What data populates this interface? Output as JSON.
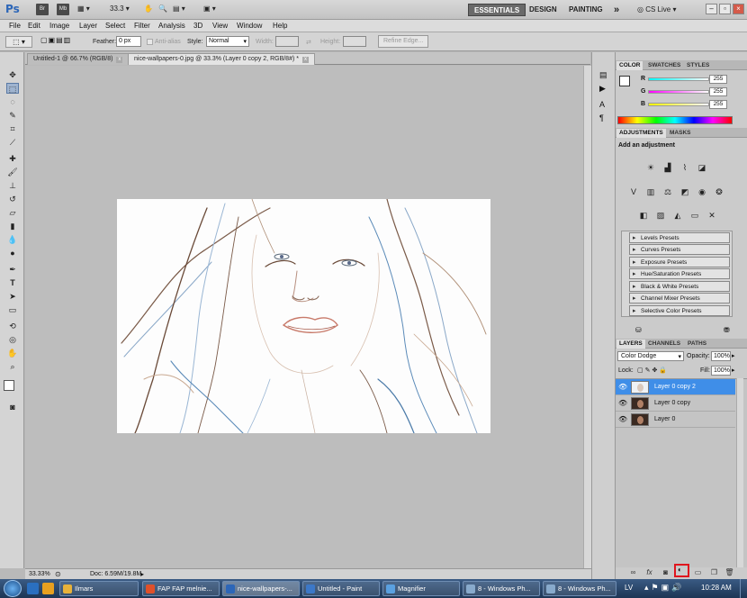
{
  "appbar": {
    "logo": "Ps",
    "icon_br": "Br",
    "icon_mb": "Mb",
    "zoom_value": "33.3",
    "workspaces": [
      "ESSENTIALS",
      "DESIGN",
      "PAINTING"
    ],
    "more": "»",
    "cslive": "CS Live"
  },
  "menu": [
    "File",
    "Edit",
    "Image",
    "Layer",
    "Select",
    "Filter",
    "Analysis",
    "3D",
    "View",
    "Window",
    "Help"
  ],
  "options": {
    "feather_label": "Feather:",
    "feather_value": "0 px",
    "antialias_label": "Anti-alias",
    "style_label": "Style:",
    "style_value": "Normal",
    "width_label": "Width:",
    "height_label": "Height:",
    "refine_label": "Refine Edge..."
  },
  "tabs": [
    {
      "label": "Untitled-1 @ 66.7% (RGB/8)",
      "close": "x"
    },
    {
      "label": "nice-wallpapers-0.jpg @ 33.3% (Layer 0 copy 2, RGB/8#) *",
      "close": "x"
    }
  ],
  "status": {
    "zoom": "33.33%",
    "doc": "Doc: 6.59M/19.8M"
  },
  "color_panel": {
    "tabs": [
      "COLOR",
      "SWATCHES",
      "STYLES"
    ],
    "channels": [
      {
        "label": "R",
        "value": "255",
        "color": "#e04040"
      },
      {
        "label": "G",
        "value": "255",
        "color": "#40c040"
      },
      {
        "label": "B",
        "value": "255",
        "color": "#4060e0"
      }
    ]
  },
  "adjustments": {
    "tabs": [
      "ADJUSTMENTS",
      "MASKS"
    ],
    "heading": "Add an adjustment",
    "presets": [
      "Levels Presets",
      "Curves Presets",
      "Exposure Presets",
      "Hue/Saturation Presets",
      "Black & White Presets",
      "Channel Mixer Presets",
      "Selective Color Presets"
    ]
  },
  "layers_panel": {
    "tabs": [
      "LAYERS",
      "CHANNELS",
      "PATHS"
    ],
    "blend_mode": "Color Dodge",
    "opacity_label": "Opacity:",
    "opacity_value": "100%",
    "lock_label": "Lock:",
    "fill_label": "Fill:",
    "fill_value": "100%",
    "layers": [
      {
        "name": "Layer 0 copy 2",
        "selected": true
      },
      {
        "name": "Layer 0 copy",
        "selected": false
      },
      {
        "name": "Layer 0",
        "selected": false
      }
    ],
    "bottom_icons": [
      "fx"
    ]
  },
  "taskbar": {
    "items": [
      {
        "label": "Ilmars",
        "color": "#e8b23a"
      },
      {
        "label": "FAP FAP melnie...",
        "color": "#e0502a"
      },
      {
        "label": "nice-wallpapers-...",
        "color": "#2c66b8"
      },
      {
        "label": "Untitled - Paint",
        "color": "#3c78c8"
      },
      {
        "label": "Magnifier",
        "color": "#5aa0e0"
      },
      {
        "label": "8 - Windows Ph...",
        "color": "#88aacc"
      },
      {
        "label": "8 - Windows Ph...",
        "color": "#88aacc"
      }
    ],
    "lang": "LV",
    "clock": "10:28 AM"
  }
}
